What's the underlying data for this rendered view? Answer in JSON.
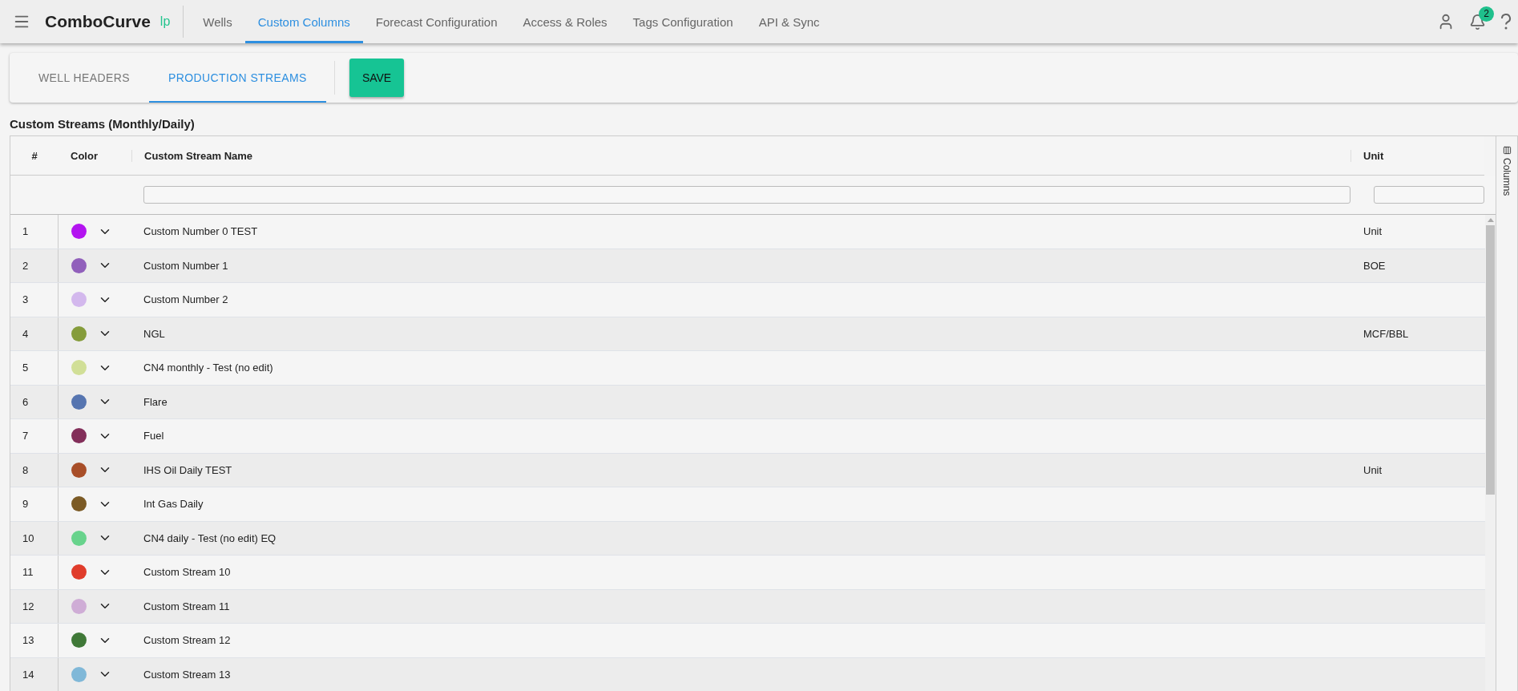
{
  "app": {
    "brand": "ComboCurve",
    "brand_tag": "lp",
    "notifications": "2"
  },
  "nav": [
    {
      "label": "Wells",
      "selected": false
    },
    {
      "label": "Custom Columns",
      "selected": true
    },
    {
      "label": "Forecast Configuration",
      "selected": false
    },
    {
      "label": "Access & Roles",
      "selected": false
    },
    {
      "label": "Tags Configuration",
      "selected": false
    },
    {
      "label": "API & Sync",
      "selected": false
    }
  ],
  "subtabs": [
    {
      "label": "WELL HEADERS",
      "selected": false
    },
    {
      "label": "PRODUCTION STREAMS",
      "selected": true
    }
  ],
  "save_button": "SAVE",
  "section_title": "Custom Streams (Monthly/Daily)",
  "table": {
    "columns": [
      "#",
      "Color",
      "Custom Stream Name",
      "Unit"
    ],
    "side_panel": "Columns",
    "rows": [
      {
        "index": "1",
        "color": "#b314f0",
        "name": "Custom Number 0 TEST",
        "unit": "Unit"
      },
      {
        "index": "2",
        "color": "#9160bb",
        "name": "Custom Number 1",
        "unit": "BOE"
      },
      {
        "index": "3",
        "color": "#d3b8ed",
        "name": "Custom Number 2",
        "unit": ""
      },
      {
        "index": "4",
        "color": "#859c3b",
        "name": "NGL",
        "unit": "MCF/BBL"
      },
      {
        "index": "5",
        "color": "#d1df97",
        "name": "CN4 monthly - Test (no edit)",
        "unit": ""
      },
      {
        "index": "6",
        "color": "#5675b0",
        "name": "Flare",
        "unit": ""
      },
      {
        "index": "7",
        "color": "#832f5a",
        "name": "Fuel",
        "unit": ""
      },
      {
        "index": "8",
        "color": "#a84e28",
        "name": "IHS Oil Daily TEST",
        "unit": "Unit"
      },
      {
        "index": "9",
        "color": "#7b5a25",
        "name": "Int Gas Daily",
        "unit": ""
      },
      {
        "index": "10",
        "color": "#68d38c",
        "name": "CN4 daily - Test (no edit) EQ",
        "unit": ""
      },
      {
        "index": "11",
        "color": "#e03c2b",
        "name": "Custom Stream 10",
        "unit": ""
      },
      {
        "index": "12",
        "color": "#cfadd6",
        "name": "Custom Stream 11",
        "unit": ""
      },
      {
        "index": "13",
        "color": "#3f7837",
        "name": "Custom Stream 12",
        "unit": ""
      },
      {
        "index": "14",
        "color": "#80b8d8",
        "name": "Custom Stream 13",
        "unit": ""
      }
    ]
  }
}
